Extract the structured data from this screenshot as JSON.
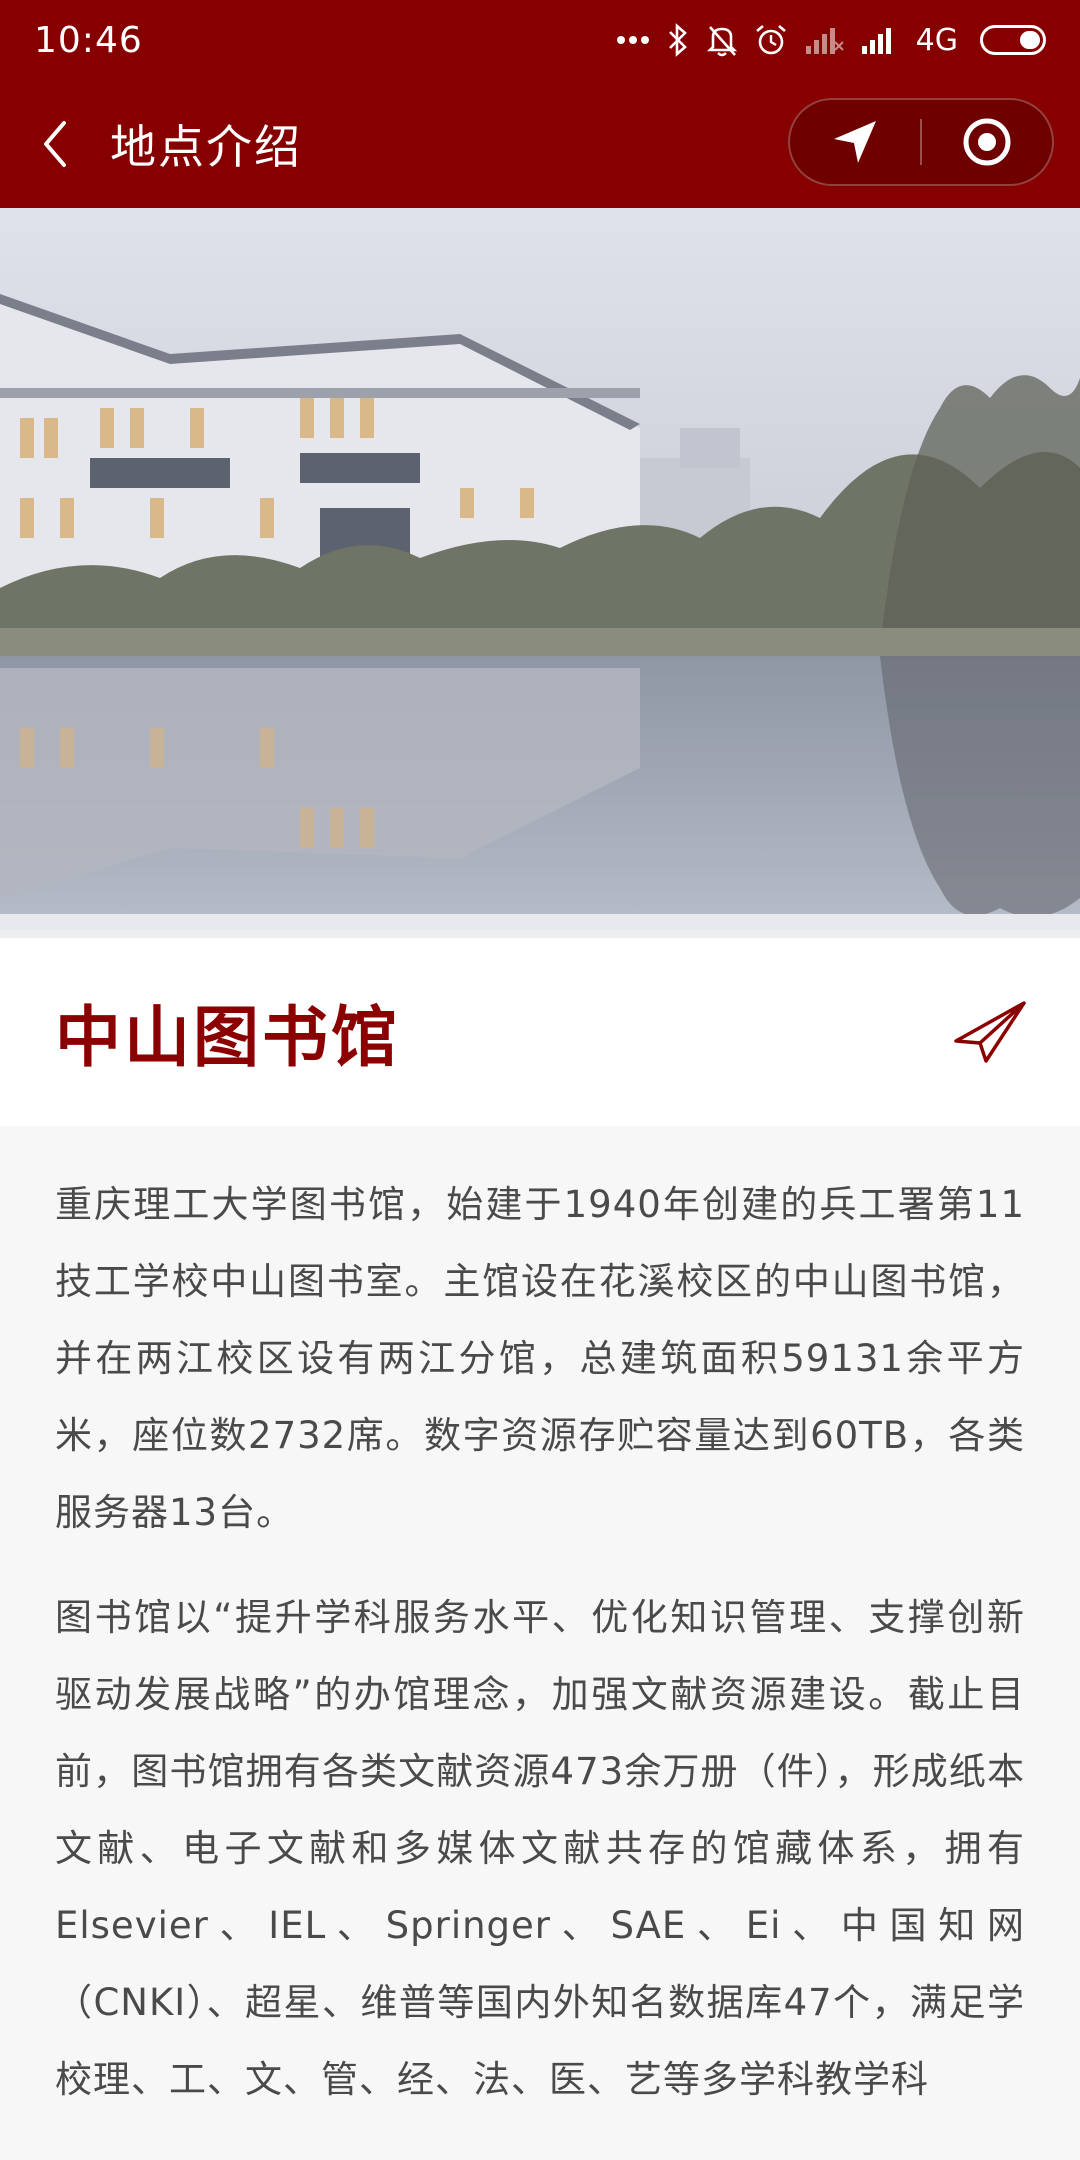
{
  "status_bar": {
    "time": "10:46",
    "network": "4G",
    "icons": [
      "dots-icon",
      "bluetooth-icon",
      "mute-icon",
      "alarm-icon",
      "signal-icon",
      "signal-icon",
      "battery-icon"
    ]
  },
  "nav": {
    "title": "地点介绍",
    "back_icon": "back-arrow-icon",
    "capsule_icons": [
      "navigate-icon",
      "record-icon"
    ]
  },
  "place": {
    "name": "中山图书馆",
    "share_icon": "paper-plane-icon"
  },
  "description": {
    "paragraphs": [
      "重庆理工大学图书馆，始建于1940年创建的兵工署第11技工学校中山图书室。主馆设在花溪校区的中山图书馆，并在两江校区设有两江分馆，总建筑面积59131余平方米，座位数2732席。数字资源存贮容量达到60TB，各类服务器13台。",
      "图书馆以“提升学科服务水平、优化知识管理、支撑创新驱动发展战略”的办馆理念，加强文献资源建设。截止目前，图书馆拥有各类文献资源473余万册（件），形成纸本文献、电子文献和多媒体文献共存的馆藏体系，拥有Elsevier、IEL、Springer、SAE、Ei、中国知网（CNKI）、超星、维普等国内外知名数据库47个，满足学校理、工、文、管、经、法、医、艺等多学科教学科"
    ]
  },
  "colors": {
    "brand": "#870000",
    "title": "#8b0000",
    "body_text": "#4a4a4a",
    "background": "#f7f7f7"
  }
}
